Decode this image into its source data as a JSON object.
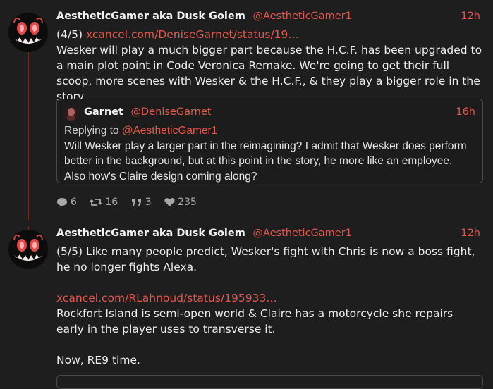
{
  "colors": {
    "accent": "#e2574c",
    "background": "#1e1e1e",
    "text": "#ececec",
    "muted": "#a8a8a8",
    "border": "#4a4a4a"
  },
  "tweet1": {
    "author_name": "AestheticGamer aka Dusk Golem",
    "author_handle": "@AestheticGamer1",
    "time": "12h",
    "prefix": "(4/5)",
    "link": "xcancel.com/DeniseGarnet/status/19…",
    "text": "Wesker will play a much bigger part because the H.C.F. has been upgraded to a main plot point in Code Veronica Remake. We're going to get their full scoop, more scenes with Wesker & the H.C.F., & they play a bigger role in the story.",
    "quote": {
      "author_name": "Garnet",
      "author_handle": "@DeniseGarnet",
      "time": "16h",
      "replying_label": "Replying to",
      "replying_handle": "@AestheticGamer1",
      "text": "Will Wesker play a larger part in the reimagining? I admit that Wesker does perform better in the background, but at this point in the story, he more like an employee. Also how's Claire design coming along?"
    },
    "stats": {
      "replies": "6",
      "retweets": "16",
      "quotes": "3",
      "likes": "235"
    }
  },
  "tweet2": {
    "author_name": "AestheticGamer aka Dusk Golem",
    "author_handle": "@AestheticGamer1",
    "time": "12h",
    "text_1": "(5/5) Like many people predict, Wesker's fight with Chris is now a boss fight, he no longer fights Alexa.",
    "link": "xcancel.com/RLahnoud/status/195933…",
    "text_2": "Rockfort Island is semi-open world & Claire has a motorcycle she repairs early in the player uses to transverse it.",
    "text_3": "Now, RE9 time."
  },
  "icons": [
    "avatar-demon-icon",
    "reply-icon",
    "retweet-icon",
    "quote-icon",
    "like-icon"
  ]
}
